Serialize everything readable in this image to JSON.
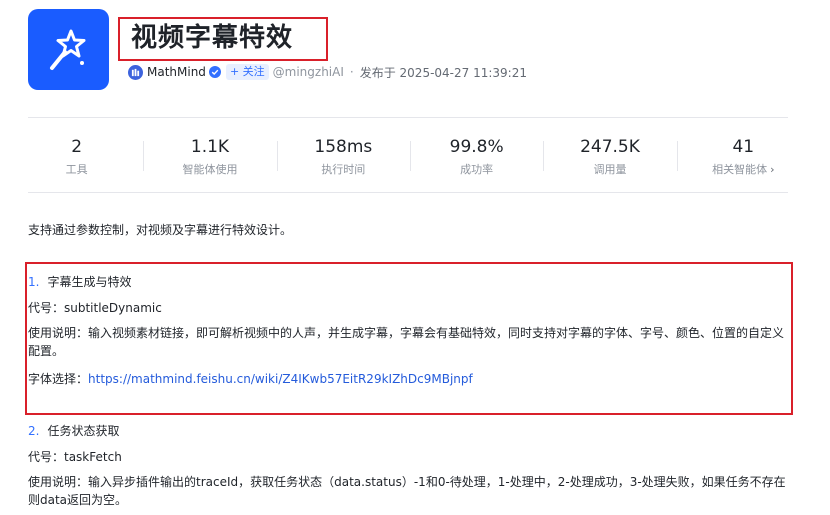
{
  "header": {
    "title": "视频字幕特效",
    "author": "MathMind",
    "follow_label": "+ 关注",
    "handle": "@mingzhiAI",
    "separator": "·",
    "published": "发布于 2025-04-27 11:39:21"
  },
  "stats": [
    {
      "value": "2",
      "label": "工具"
    },
    {
      "value": "1.1K",
      "label": "智能体使用"
    },
    {
      "value": "158ms",
      "label": "执行时间"
    },
    {
      "value": "99.8%",
      "label": "成功率"
    },
    {
      "value": "247.5K",
      "label": "调用量"
    },
    {
      "value": "41",
      "label": "相关智能体"
    }
  ],
  "description": "支持通过参数控制，对视频及字幕进行特效设计。",
  "tools": [
    {
      "number": "1.",
      "name": "字幕生成与特效",
      "code": "代号：subtitleDynamic",
      "usage": "使用说明：输入视频素材链接，即可解析视频中的人声，并生成字幕，字幕会有基础特效，同时支持对字幕的字体、字号、颜色、位置的自定义配置。",
      "font_label": "字体选择：",
      "font_link": "https://mathmind.feishu.cn/wiki/Z4IKwb57EitR29kIZhDc9MBjnpf"
    },
    {
      "number": "2.",
      "name": "任务状态获取",
      "code": "代号：taskFetch",
      "usage": "使用说明：输入异步插件输出的traceId，获取任务状态（data.status）-1和0-待处理，1-处理中，2-处理成功，3-处理失败，如果任务不存在则data返回为空。"
    }
  ],
  "colors": {
    "accent": "#1a5cff",
    "link": "#245bdb",
    "highlight": "#d9202a"
  }
}
